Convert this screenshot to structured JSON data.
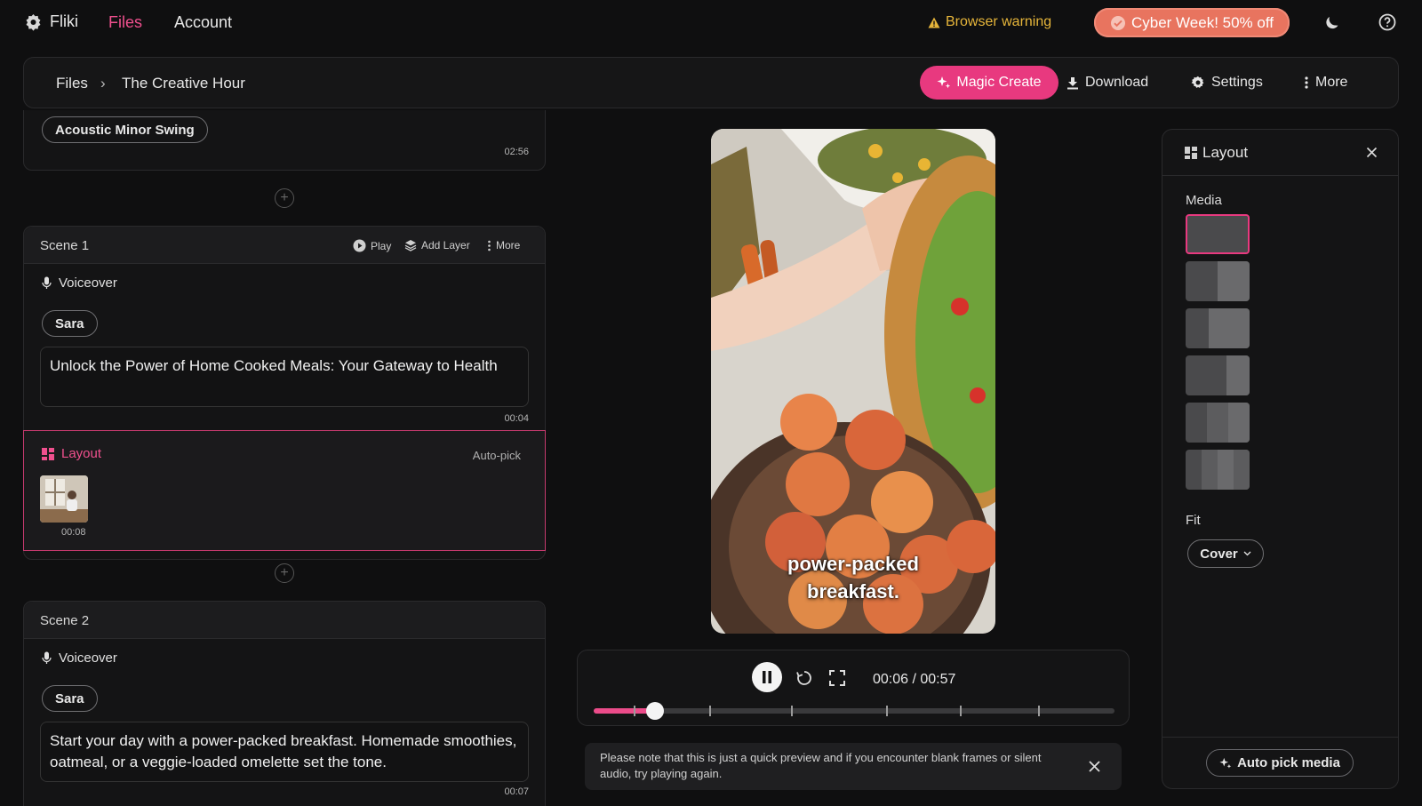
{
  "topbar": {
    "brand": "Fliki",
    "nav": [
      "Files",
      "Account"
    ],
    "warning": "Browser warning",
    "promo": "Cyber Week! 50% off"
  },
  "toolbar": {
    "breadcrumb_root": "Files",
    "breadcrumb_current": "The Creative Hour",
    "magic_create": "Magic Create",
    "download": "Download",
    "settings": "Settings",
    "more": "More"
  },
  "music": {
    "track": "Acoustic Minor Swing",
    "duration": "02:56"
  },
  "scene1": {
    "title": "Scene 1",
    "play": "Play",
    "add_layer": "Add Layer",
    "more": "More",
    "voiceover_label": "Voiceover",
    "voice": "Sara",
    "script": "Unlock the Power of Home Cooked Meals: Your Gateway to Health",
    "script_duration": "00:04",
    "layout_label": "Layout",
    "auto_pick": "Auto-pick",
    "media_duration": "00:08"
  },
  "scene2": {
    "title": "Scene 2",
    "voiceover_label": "Voiceover",
    "voice": "Sara",
    "script": "Start your day with a power-packed breakfast. Homemade smoothies, oatmeal, or a veggie-loaded omelette set the tone.",
    "script_duration": "00:07"
  },
  "preview": {
    "caption_line1": "power-packed",
    "caption_line2": "breakfast.",
    "time": "00:06 / 00:57",
    "progress": 0.117,
    "notice": "Please note that this is just a quick preview and if you encounter blank frames or silent audio, try playing again."
  },
  "layout_panel": {
    "title": "Layout",
    "media_label": "Media",
    "fit_label": "Fit",
    "fit_value": "Cover",
    "auto_pick_button": "Auto pick media"
  },
  "colors": {
    "accent": "#e8397f",
    "warning": "#e6b53a",
    "promo": "#e8745f"
  }
}
